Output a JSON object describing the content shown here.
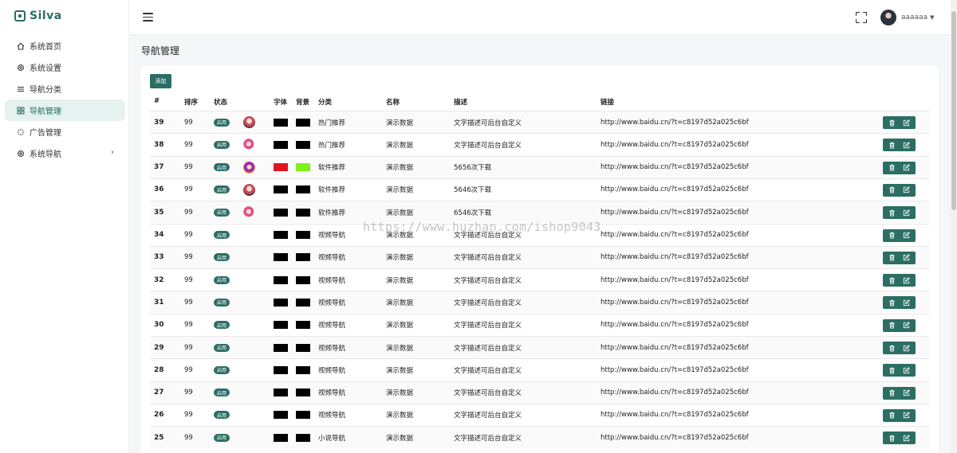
{
  "app": {
    "name": "Silva"
  },
  "sidebar": {
    "items": [
      {
        "label": "系统首页",
        "icon": "home-icon",
        "active": false
      },
      {
        "label": "系统设置",
        "icon": "gear-icon",
        "active": false
      },
      {
        "label": "导航分类",
        "icon": "list-icon",
        "active": false
      },
      {
        "label": "导航管理",
        "icon": "grid-icon",
        "active": true
      },
      {
        "label": "广告管理",
        "icon": "loader-icon",
        "active": false
      },
      {
        "label": "系统导航",
        "icon": "gear-icon",
        "active": false,
        "has_submenu": true
      }
    ]
  },
  "header": {
    "username": "aaaaaa"
  },
  "page": {
    "title": "导航管理",
    "add_label": "添加"
  },
  "table": {
    "columns": {
      "id": "#",
      "sort": "排序",
      "status": "状态",
      "font": "字体",
      "bg": "背景",
      "category": "分类",
      "name": "名称",
      "desc": "描述",
      "link": "链接"
    },
    "rows": [
      {
        "id": "39",
        "sort": "99",
        "status": "启用",
        "avatar": "avatar-a",
        "font_color": "#000000",
        "bg_color": "#000000",
        "category": "热门推荐",
        "name": "演示数据",
        "desc": "文字描述可后台自定义",
        "link": "http://www.baidu.cn/?t=c8197d52a025c6bf"
      },
      {
        "id": "38",
        "sort": "99",
        "status": "启用",
        "avatar": "avatar-b",
        "font_color": "#000000",
        "bg_color": "#000000",
        "category": "热门推荐",
        "name": "演示数据",
        "desc": "文字描述可后台自定义",
        "link": "http://www.baidu.cn/?t=c8197d52a025c6bf"
      },
      {
        "id": "37",
        "sort": "99",
        "status": "启用",
        "avatar": "avatar-c",
        "font_color": "#e0161d",
        "bg_color": "#7ef21a",
        "category": "软件推荐",
        "name": "演示数据",
        "desc": "5656次下载",
        "link": "http://www.baidu.cn/?t=c8197d52a025c6bf"
      },
      {
        "id": "36",
        "sort": "99",
        "status": "启用",
        "avatar": "avatar-a",
        "font_color": "#000000",
        "bg_color": "#000000",
        "category": "软件推荐",
        "name": "演示数据",
        "desc": "5646次下载",
        "link": "http://www.baidu.cn/?t=c8197d52a025c6bf"
      },
      {
        "id": "35",
        "sort": "99",
        "status": "启用",
        "avatar": "avatar-b",
        "font_color": "#000000",
        "bg_color": "#000000",
        "category": "软件推荐",
        "name": "演示数据",
        "desc": "6546次下载",
        "link": "http://www.baidu.cn/?t=c8197d52a025c6bf"
      },
      {
        "id": "34",
        "sort": "99",
        "status": "启用",
        "avatar": "",
        "font_color": "#000000",
        "bg_color": "#000000",
        "category": "视频导航",
        "name": "演示数据",
        "desc": "文字描述可后台自定义",
        "link": "http://www.baidu.cn/?t=c8197d52a025c6bf"
      },
      {
        "id": "33",
        "sort": "99",
        "status": "启用",
        "avatar": "",
        "font_color": "#000000",
        "bg_color": "#000000",
        "category": "视频导航",
        "name": "演示数据",
        "desc": "文字描述可后台自定义",
        "link": "http://www.baidu.cn/?t=c8197d52a025c6bf"
      },
      {
        "id": "32",
        "sort": "99",
        "status": "启用",
        "avatar": "",
        "font_color": "#000000",
        "bg_color": "#000000",
        "category": "视频导航",
        "name": "演示数据",
        "desc": "文字描述可后台自定义",
        "link": "http://www.baidu.cn/?t=c8197d52a025c6bf"
      },
      {
        "id": "31",
        "sort": "99",
        "status": "启用",
        "avatar": "",
        "font_color": "#000000",
        "bg_color": "#000000",
        "category": "视频导航",
        "name": "演示数据",
        "desc": "文字描述可后台自定义",
        "link": "http://www.baidu.cn/?t=c8197d52a025c6bf"
      },
      {
        "id": "30",
        "sort": "99",
        "status": "启用",
        "avatar": "",
        "font_color": "#000000",
        "bg_color": "#000000",
        "category": "视频导航",
        "name": "演示数据",
        "desc": "文字描述可后台自定义",
        "link": "http://www.baidu.cn/?t=c8197d52a025c6bf"
      },
      {
        "id": "29",
        "sort": "99",
        "status": "启用",
        "avatar": "",
        "font_color": "#000000",
        "bg_color": "#000000",
        "category": "视频导航",
        "name": "演示数据",
        "desc": "文字描述可后台自定义",
        "link": "http://www.baidu.cn/?t=c8197d52a025c6bf"
      },
      {
        "id": "28",
        "sort": "99",
        "status": "启用",
        "avatar": "",
        "font_color": "#000000",
        "bg_color": "#000000",
        "category": "视频导航",
        "name": "演示数据",
        "desc": "文字描述可后台自定义",
        "link": "http://www.baidu.cn/?t=c8197d52a025c6bf"
      },
      {
        "id": "27",
        "sort": "99",
        "status": "启用",
        "avatar": "",
        "font_color": "#000000",
        "bg_color": "#000000",
        "category": "视频导航",
        "name": "演示数据",
        "desc": "文字描述可后台自定义",
        "link": "http://www.baidu.cn/?t=c8197d52a025c6bf"
      },
      {
        "id": "26",
        "sort": "99",
        "status": "启用",
        "avatar": "",
        "font_color": "#000000",
        "bg_color": "#000000",
        "category": "视频导航",
        "name": "演示数据",
        "desc": "文字描述可后台自定义",
        "link": "http://www.baidu.cn/?t=c8197d52a025c6bf"
      },
      {
        "id": "25",
        "sort": "99",
        "status": "启用",
        "avatar": "",
        "font_color": "#000000",
        "bg_color": "#000000",
        "category": "小说导航",
        "name": "演示数据",
        "desc": "文字描述可后台自定义",
        "link": "http://www.baidu.cn/?t=c8197d52a025c6bf"
      }
    ]
  },
  "watermark": "https://www.huzhan.com/ishop9043",
  "colors": {
    "accent": "#2b6e63",
    "active_bg": "#e6f2ef"
  }
}
